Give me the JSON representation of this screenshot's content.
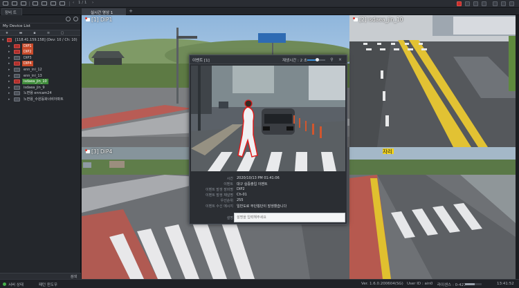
{
  "toolbar": {
    "page_indicator": "1 / 1"
  },
  "tabs": {
    "left_panel_tab": "장비 트리",
    "live_tab": "실시간 영상 1"
  },
  "device_panel": {
    "title": "My Device List",
    "root_node": "[118.41.159.158] (Dev: 10 / Ch: 10)",
    "devices": [
      {
        "label": "DIP1",
        "icon": "camera-red",
        "highlight": "orange"
      },
      {
        "label": "DIP2",
        "icon": "camera-red",
        "highlight": "orange"
      },
      {
        "label": "DIP3",
        "icon": "camera",
        "highlight": "none"
      },
      {
        "label": "DIP4",
        "icon": "camera-red",
        "highlight": "orange"
      },
      {
        "label": "enn_ini_12",
        "icon": "camera",
        "highlight": "none"
      },
      {
        "label": "enn_ini_13",
        "icon": "camera",
        "highlight": "none"
      },
      {
        "label": "isdaea_jin_10",
        "icon": "camera-red",
        "highlight": "green"
      },
      {
        "label": "isdaea_jin_9",
        "icon": "camera",
        "highlight": "none"
      },
      {
        "label": "노면용 enrcam24",
        "icon": "camera",
        "highlight": "none"
      },
      {
        "label": "노면용_수원등화너비아파트",
        "icon": "camera",
        "highlight": "none"
      }
    ],
    "search_label": "검색"
  },
  "cameras": [
    {
      "label": "[1] DIP1"
    },
    {
      "label": "[2] isdaea_jin_10"
    },
    {
      "label": "[3] DIP4"
    },
    {
      "label": "자리"
    }
  ],
  "event_dialog": {
    "title": "이벤트 [1]",
    "playtime_label": "재생시간 :",
    "playtime_value": "2 초",
    "slider_fraction": 0.55,
    "fields": [
      {
        "key": "시간",
        "value": "2020/10/13 PM 01:41:06"
      },
      {
        "key": "이벤트",
        "value": "대구 실증출입 이벤트"
      },
      {
        "key": "이벤트 발생 장비명",
        "value": "DIP2"
      },
      {
        "key": "이벤트 발생 채널명",
        "value": "Ch-01"
      },
      {
        "key": "우선순위",
        "value": "255"
      },
      {
        "key": "이벤트 수신 메시지",
        "value": "일반도로 무단횡단이 발생했습니다"
      }
    ],
    "action_label": "설명",
    "action_placeholder": "설명을 입력해주세요"
  },
  "statusbar": {
    "server_status": "서버 상태",
    "layout_label": "패턴 윈도우",
    "version": "Ver. 1.6.0.200604(SG)",
    "user": "User ID : ain0",
    "license": "라이센스 : 0-427",
    "time": "13:41:52"
  },
  "colors": {
    "panel_bg": "#24272c",
    "highlight_orange": "#c84a2a",
    "highlight_green": "#3f8b3a",
    "accent_blue": "#3b8fd9",
    "rec_red": "#e23b2f"
  }
}
